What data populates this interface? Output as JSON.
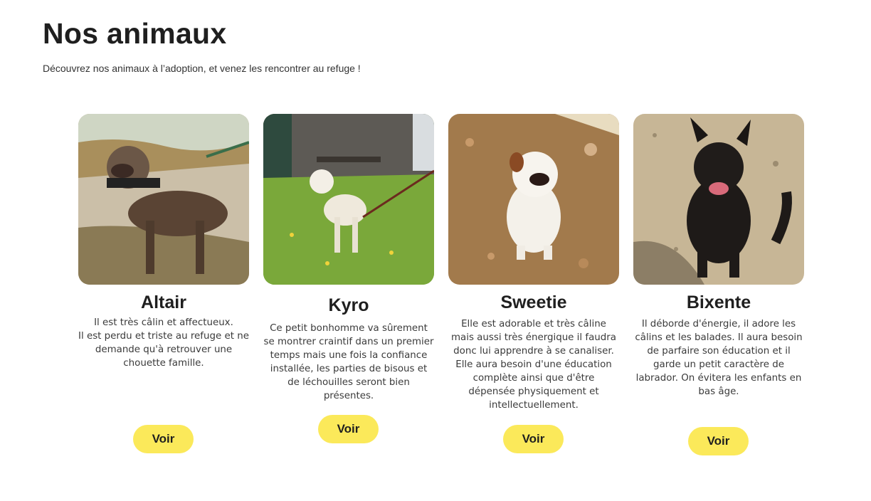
{
  "header": {
    "title": "Nos animaux",
    "subtitle": "Découvrez nos animaux à l’adoption, et venez les rencontrer au refuge !"
  },
  "animals": [
    {
      "name": "Altair",
      "description": "Il est très câlin et affectueux.\nIl est perdu et triste au refuge et ne demande qu'à retrouver une chouette famille.",
      "button": "Voir"
    },
    {
      "name": "Kyro",
      "description": "Ce petit bonhomme va sûrement se montrer craintif dans un premier temps mais une fois la confiance installée, les parties de bisous et de léchouilles seront bien présentes.",
      "button": "Voir"
    },
    {
      "name": "Sweetie",
      "description": "Elle est adorable et très câline mais aussi très énergique il faudra donc lui apprendre à se canaliser. Elle aura besoin d'une éducation complète ainsi que d'être dépensée physiquement et intellectuellement.",
      "button": "Voir"
    },
    {
      "name": "Bixente",
      "description": "Il déborde d'énergie, il adore les câlins et les balades. Il aura besoin de parfaire son éducation et il garde un petit caractère de labrador. On évitera les enfants en bas âge.",
      "button": "Voir"
    }
  ],
  "colors": {
    "button_bg": "#fbe95a",
    "text_dark": "#1f1f1f"
  }
}
